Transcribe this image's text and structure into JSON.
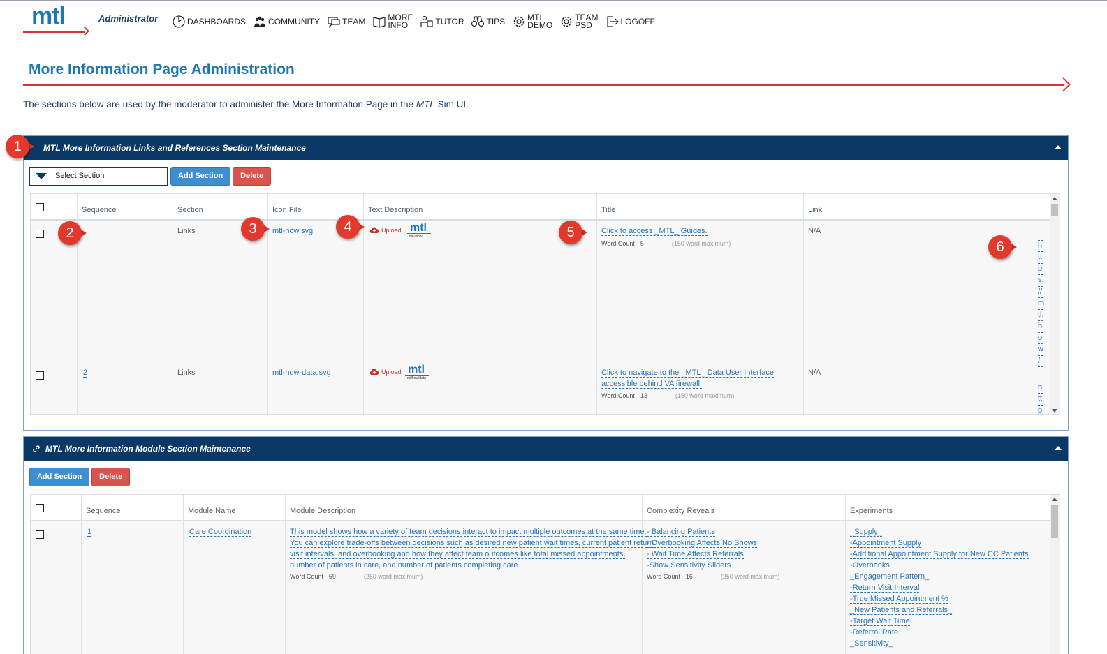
{
  "header": {
    "logo": "mtl",
    "role": "Administrator",
    "nav": [
      {
        "id": "dashboards",
        "label": "DASHBOARDS",
        "icon": "dashboard-icon"
      },
      {
        "id": "community",
        "label": "COMMUNITY",
        "icon": "community-icon"
      },
      {
        "id": "team",
        "label": "TEAM",
        "icon": "team-icon"
      },
      {
        "id": "more-info",
        "label": "MORE INFO",
        "line1": "MORE",
        "line2": "INFO",
        "icon": "book-icon"
      },
      {
        "id": "tutor",
        "label": "TUTOR",
        "icon": "tutor-icon"
      },
      {
        "id": "tips",
        "label": "TIPS",
        "icon": "binoculars-icon"
      },
      {
        "id": "mtl-demo",
        "label": "MTL DEMO",
        "line1": "MTL",
        "line2": "DEMO",
        "icon": "gear-icon"
      },
      {
        "id": "team-psd",
        "label": "TEAM PSD",
        "line1": "TEAM",
        "line2": "PSD",
        "icon": "gear-icon"
      },
      {
        "id": "logoff",
        "label": "LOGOFF",
        "icon": "logoff-icon"
      }
    ]
  },
  "page": {
    "title": "More Information Page Administration",
    "intro_before": "The sections below are used by the moderator to administer the More Information Page in the ",
    "intro_em": "MTL",
    "intro_after": " Sim UI."
  },
  "links_panel": {
    "title": "MTL More Information Links and References Section Maintenance",
    "select_value": "Select Section",
    "add_label": "Add Section",
    "delete_label": "Delete",
    "columns": [
      "Sequence",
      "Section",
      "Icon File",
      "Text Description",
      "Title",
      "Link"
    ],
    "rows": [
      {
        "sequence": "",
        "section": "Links",
        "icon_file": "mtl-how.svg",
        "upload": "Upload",
        "logo_caption": "mtl2how",
        "title_lines": [
          "Click to access _MTL_ Guides."
        ],
        "word_count": "Word Count -  5",
        "word_max": "(150 word maximum)",
        "link": "N/A",
        "side_chars": [
          ".",
          "h",
          "tt",
          "p",
          "s:",
          "//",
          "m",
          "tl.",
          "h",
          "o",
          "w",
          "/"
        ]
      },
      {
        "sequence": "2",
        "section": "Links",
        "icon_file": "mtl-how-data.svg",
        "upload": "Upload",
        "logo_caption": "mtlhow/data",
        "title_lines": [
          "Click to navigate to the _MTL_ Data User Interface",
          "accessible behind VA firewall."
        ],
        "word_count": "Word Count -  13",
        "word_max": "(150 word maximum)",
        "link": "N/A",
        "side_chars": [
          ".",
          "h",
          "tt",
          "p"
        ]
      }
    ]
  },
  "module_panel": {
    "title": "MTL More Information Module Section Maintenance",
    "add_label": "Add Section",
    "delete_label": "Delete",
    "columns": [
      "Sequence",
      "Module Name",
      "Module Description",
      "Complexity Reveals",
      "Experiments"
    ],
    "row": {
      "sequence": "1",
      "module_name": "Care Coordination",
      "description_lines": [
        "This model shows how a variety of team decisions interact to impact multiple outcomes at the same time.",
        "You can explore trade-offs between decisions such as desired new patient wait times, current patient return",
        "visit intervals, and overbooking and how they affect team outcomes like total missed appointments,",
        "number of patients in care, and number of patients completing care."
      ],
      "desc_word_count": "Word Count -  59",
      "desc_word_max": "(250 word maximum)",
      "complexity": [
        "- Balancing Patients",
        "- Overbooking Affects No Shows",
        "- Wait Time Affects Referrals",
        "-Show Sensitivity Sliders"
      ],
      "complexity_word_count": "Word Count -  16",
      "complexity_word_max": "(250 word maximum)",
      "experiments": [
        "_Supply_",
        "-Appointment Supply",
        "-Additional Appointment Supply for New CC Patients",
        "-Overbooks",
        "_Engagement Pattern_",
        "-Return Visit Interval",
        "-True Missed Appointment %",
        "_New Patients and Referrals_",
        "-Target Wait Time",
        "-Referral Rate",
        "_Sensitivity_"
      ]
    }
  },
  "callouts": [
    "1",
    "2",
    "3",
    "4",
    "5",
    "6"
  ],
  "colors": {
    "brand_blue": "#1d77b5",
    "header_navy": "#0c3865",
    "accent_red": "#d9303a",
    "callout_red": "#e2392c"
  }
}
